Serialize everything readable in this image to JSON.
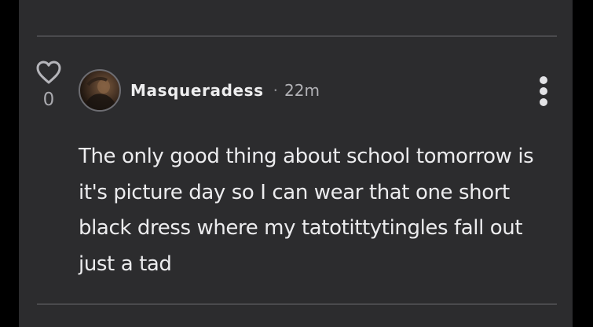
{
  "post": {
    "like_count": "0",
    "author": "Masqueradess",
    "separator": "·",
    "timestamp": "22m",
    "text": "The only good thing about school tomorrow is it's picture day so I can wear that one short black dress where my tatotittytingles fall out just a tad"
  },
  "icons": {
    "like": "heart-outline-icon",
    "more": "vertical-ellipsis-icon"
  },
  "colors": {
    "background": "#000000",
    "card": "#2c2c2e",
    "divider": "#4a4a4d",
    "text": "#ececee",
    "muted": "#a9a9ae"
  }
}
